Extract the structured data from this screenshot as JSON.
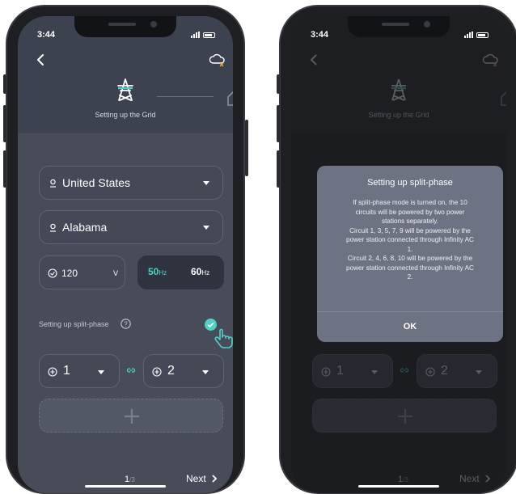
{
  "status_bar": {
    "time": "3:44"
  },
  "header": {
    "step_label": "Setting up the Grid"
  },
  "form": {
    "country": "United States",
    "state": "Alabama",
    "voltage_value": "120",
    "voltage_unit": "V",
    "frequency_options": [
      {
        "value": "50",
        "unit": "Hz",
        "selected": true
      },
      {
        "value": "60",
        "unit": "Hz",
        "selected": false
      }
    ],
    "split_phase_label": "Setting up split-phase",
    "split_phase_enabled": true,
    "circuit_a": "1",
    "circuit_b": "2"
  },
  "footer": {
    "page_current": "1",
    "page_total": "/3",
    "next_label": "Next"
  },
  "dialog": {
    "title": "Setting up split-phase",
    "body_lines": [
      "If split-phase mode is turned on, the 10",
      "circuits will be powered by two power",
      "stations separately.",
      "Circuit 1, 3, 5, 7, 9 will be powered by the",
      "power station connected through Infinity AC",
      "1.",
      "Circuit 2, 4, 6, 8, 10 will be powered by the",
      "power station connected through Infinity AC",
      "2."
    ],
    "ok_label": "OK"
  },
  "colors": {
    "accent": "#4fd1c5",
    "screen_bg": "#484c59",
    "dialog_bg": "#6e7383"
  }
}
